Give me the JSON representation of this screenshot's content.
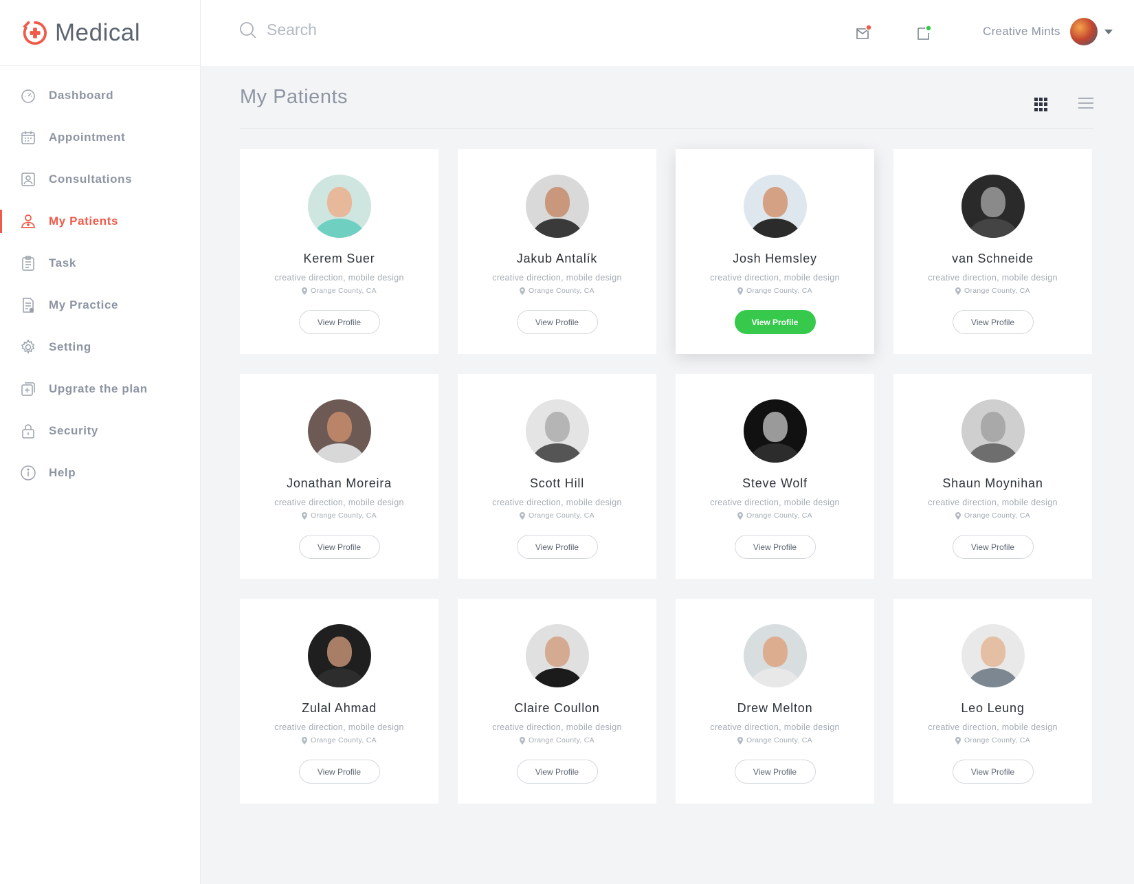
{
  "app": {
    "name": "Medical",
    "accent": "#f05a4a",
    "success": "#36c94c"
  },
  "sidebar": {
    "items": [
      {
        "label": "Dashboard",
        "icon": "dashboard-icon",
        "active": false
      },
      {
        "label": "Appointment",
        "icon": "calendar-icon",
        "active": false
      },
      {
        "label": "Consultations",
        "icon": "consultation-icon",
        "active": false
      },
      {
        "label": "My Patients",
        "icon": "patient-icon",
        "active": true
      },
      {
        "label": "Task",
        "icon": "clipboard-icon",
        "active": false
      },
      {
        "label": "My Practice",
        "icon": "document-icon",
        "active": false
      },
      {
        "label": "Setting",
        "icon": "gear-icon",
        "active": false
      },
      {
        "label": "Upgrate the plan",
        "icon": "add-square-icon",
        "active": false
      },
      {
        "label": "Security",
        "icon": "lock-icon",
        "active": false
      },
      {
        "label": "Help",
        "icon": "info-icon",
        "active": false
      }
    ]
  },
  "header": {
    "search_placeholder": "Search",
    "user_name": "Creative Mints",
    "mail_badge_color": "#f05a4a",
    "notify_badge_color": "#36c94c"
  },
  "main": {
    "title": "My Patients",
    "patients": [
      {
        "name": "Kerem Suer",
        "role": "creative direction, mobile design",
        "location": "Orange County, CA",
        "button": "View Profile",
        "highlight": false
      },
      {
        "name": "Jakub Antalík",
        "role": "creative direction, mobile design",
        "location": "Orange County, CA",
        "button": "View Profile",
        "highlight": false
      },
      {
        "name": "Josh Hemsley",
        "role": "creative direction, mobile design",
        "location": "Orange County, CA",
        "button": "View Profile",
        "highlight": true
      },
      {
        "name": "van Schneide",
        "role": "creative direction, mobile design",
        "location": "Orange County, CA",
        "button": "View Profile",
        "highlight": false
      },
      {
        "name": "Jonathan Moreira",
        "role": "creative direction, mobile design",
        "location": "Orange County, CA",
        "button": "View Profile",
        "highlight": false
      },
      {
        "name": "Scott Hill",
        "role": "creative direction, mobile design",
        "location": "Orange County, CA",
        "button": "View Profile",
        "highlight": false
      },
      {
        "name": "Steve Wolf",
        "role": "creative direction, mobile design",
        "location": "Orange County, CA",
        "button": "View Profile",
        "highlight": false
      },
      {
        "name": "Shaun Moynihan",
        "role": "creative direction, mobile design",
        "location": "Orange County, CA",
        "button": "View Profile",
        "highlight": false
      },
      {
        "name": "Zulal Ahmad",
        "role": "creative direction, mobile design",
        "location": "Orange County, CA",
        "button": "View Profile",
        "highlight": false
      },
      {
        "name": "Claire Coullon",
        "role": "creative direction, mobile design",
        "location": "Orange County, CA",
        "button": "View Profile",
        "highlight": false
      },
      {
        "name": "Drew Melton",
        "role": "creative direction, mobile design",
        "location": "Orange County, CA",
        "button": "View Profile",
        "highlight": false
      },
      {
        "name": "Leo Leung",
        "role": "creative direction, mobile design",
        "location": "Orange County, CA",
        "button": "View Profile",
        "highlight": false
      }
    ]
  }
}
